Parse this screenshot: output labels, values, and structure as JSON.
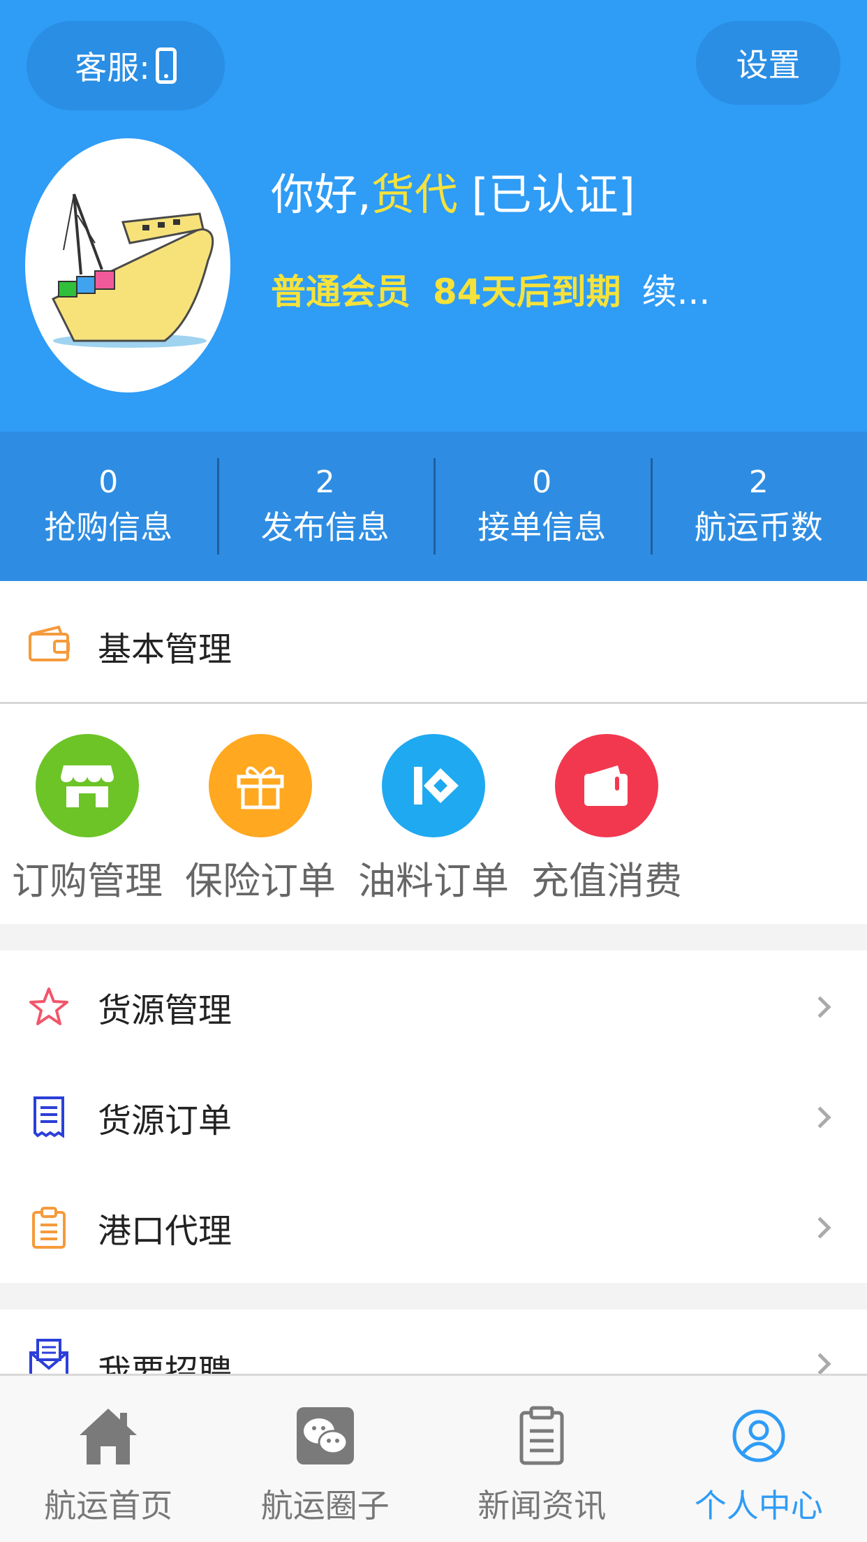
{
  "header": {
    "service_label": "客服:",
    "settings_label": "设置",
    "greeting_prefix": "你好,",
    "user_role": "货代",
    "verified_tag": "[已认证]",
    "member_level": "普通会员",
    "expiry_text": "84天后到期",
    "renew_text": "续..."
  },
  "stats": [
    {
      "value": "0",
      "label": "抢购信息"
    },
    {
      "value": "2",
      "label": "发布信息"
    },
    {
      "value": "0",
      "label": "接单信息"
    },
    {
      "value": "2",
      "label": "航运币数"
    }
  ],
  "basic_section": {
    "title": "基本管理"
  },
  "shortcuts": [
    {
      "label": "订购管理",
      "icon": "shop-icon",
      "color": "#6cc427"
    },
    {
      "label": "保险订单",
      "icon": "gift-icon",
      "color": "#ffa820"
    },
    {
      "label": "油料订单",
      "icon": "tag-icon",
      "color": "#1fa9f0"
    },
    {
      "label": "充值消费",
      "icon": "wallet-icon",
      "color": "#f2384f"
    }
  ],
  "menu": [
    {
      "label": "货源管理",
      "icon": "star-icon"
    },
    {
      "label": "货源订单",
      "icon": "receipt-icon"
    },
    {
      "label": "港口代理",
      "icon": "clipboard-icon"
    }
  ],
  "menu2": [
    {
      "label": "我要招聘",
      "icon": "mail-icon"
    }
  ],
  "tabbar": [
    {
      "label": "航运首页",
      "icon": "home-icon",
      "active": false
    },
    {
      "label": "航运圈子",
      "icon": "wechat-icon",
      "active": false
    },
    {
      "label": "新闻资讯",
      "icon": "news-icon",
      "active": false
    },
    {
      "label": "个人中心",
      "icon": "profile-icon",
      "active": true
    }
  ],
  "colors": {
    "primary": "#2f9cf6",
    "stats_bg": "#2e8de2",
    "highlight_yellow": "#f5e23b",
    "active_tab": "#2f9cf6"
  }
}
